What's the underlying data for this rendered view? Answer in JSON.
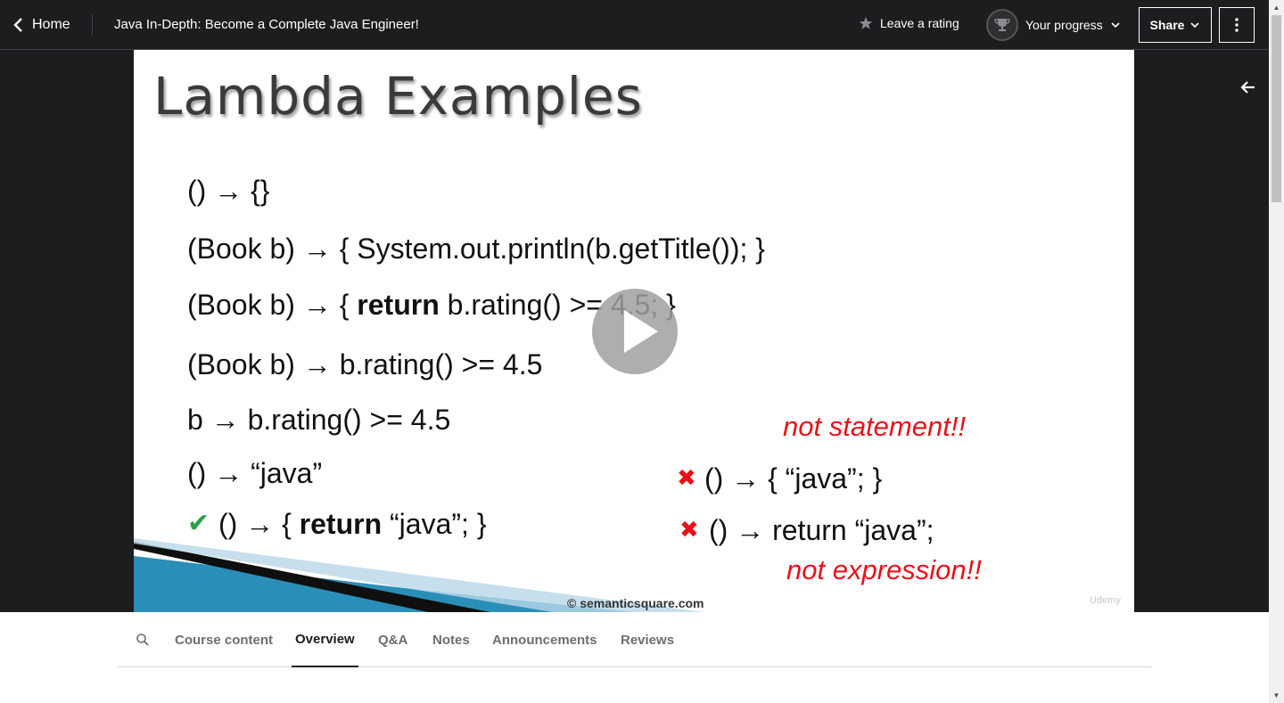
{
  "header": {
    "home_label": "Home",
    "course_title": "Java In-Depth: Become a Complete Java Engineer!",
    "rating_label": "Leave a rating",
    "progress_label": "Your progress",
    "share_label": "Share"
  },
  "slide": {
    "title": "Lambda Examples",
    "lines": [
      {
        "pre": "() → {}",
        "bold": "",
        "post": ""
      },
      {
        "pre": "(Book b) → { System.out.println(b.getTitle()); }",
        "bold": "",
        "post": ""
      },
      {
        "pre": "(Book b) → { ",
        "bold": "return",
        "post": " b.rating() >=  4.5; }"
      },
      {
        "pre": "(Book b) → b.rating() >=  4.5",
        "bold": "",
        "post": ""
      },
      {
        "pre": "b → b.rating() >=  4.5",
        "bold": "",
        "post": ""
      },
      {
        "pre": "() → “java”",
        "bold": "",
        "post": ""
      },
      {
        "pre": "() → { ",
        "bold": "return",
        "post": " “java”; }"
      }
    ],
    "wrong_1": "() → { “java”; }",
    "wrong_2": "() → return “java”;",
    "note_statement": "not statement!!",
    "note_expression": "not expression!!",
    "copyright": "© semanticsquare.com",
    "watermark": "Udemy",
    "check_glyph": "✔",
    "x_glyph": "✖"
  },
  "tabs": [
    {
      "label": "Course content",
      "active": false
    },
    {
      "label": "Overview",
      "active": true
    },
    {
      "label": "Q&A",
      "active": false
    },
    {
      "label": "Notes",
      "active": false
    },
    {
      "label": "Announcements",
      "active": false
    },
    {
      "label": "Reviews",
      "active": false
    }
  ],
  "icons": [
    "chevron-left-icon",
    "star-icon",
    "trophy-icon",
    "chevron-down-icon",
    "more-vertical-icon",
    "play-icon",
    "arrow-left-icon",
    "search-icon"
  ],
  "colors": {
    "header_bg": "#1c1d1f",
    "accent_red": "#e8111a",
    "check_green": "#2aa14a"
  }
}
